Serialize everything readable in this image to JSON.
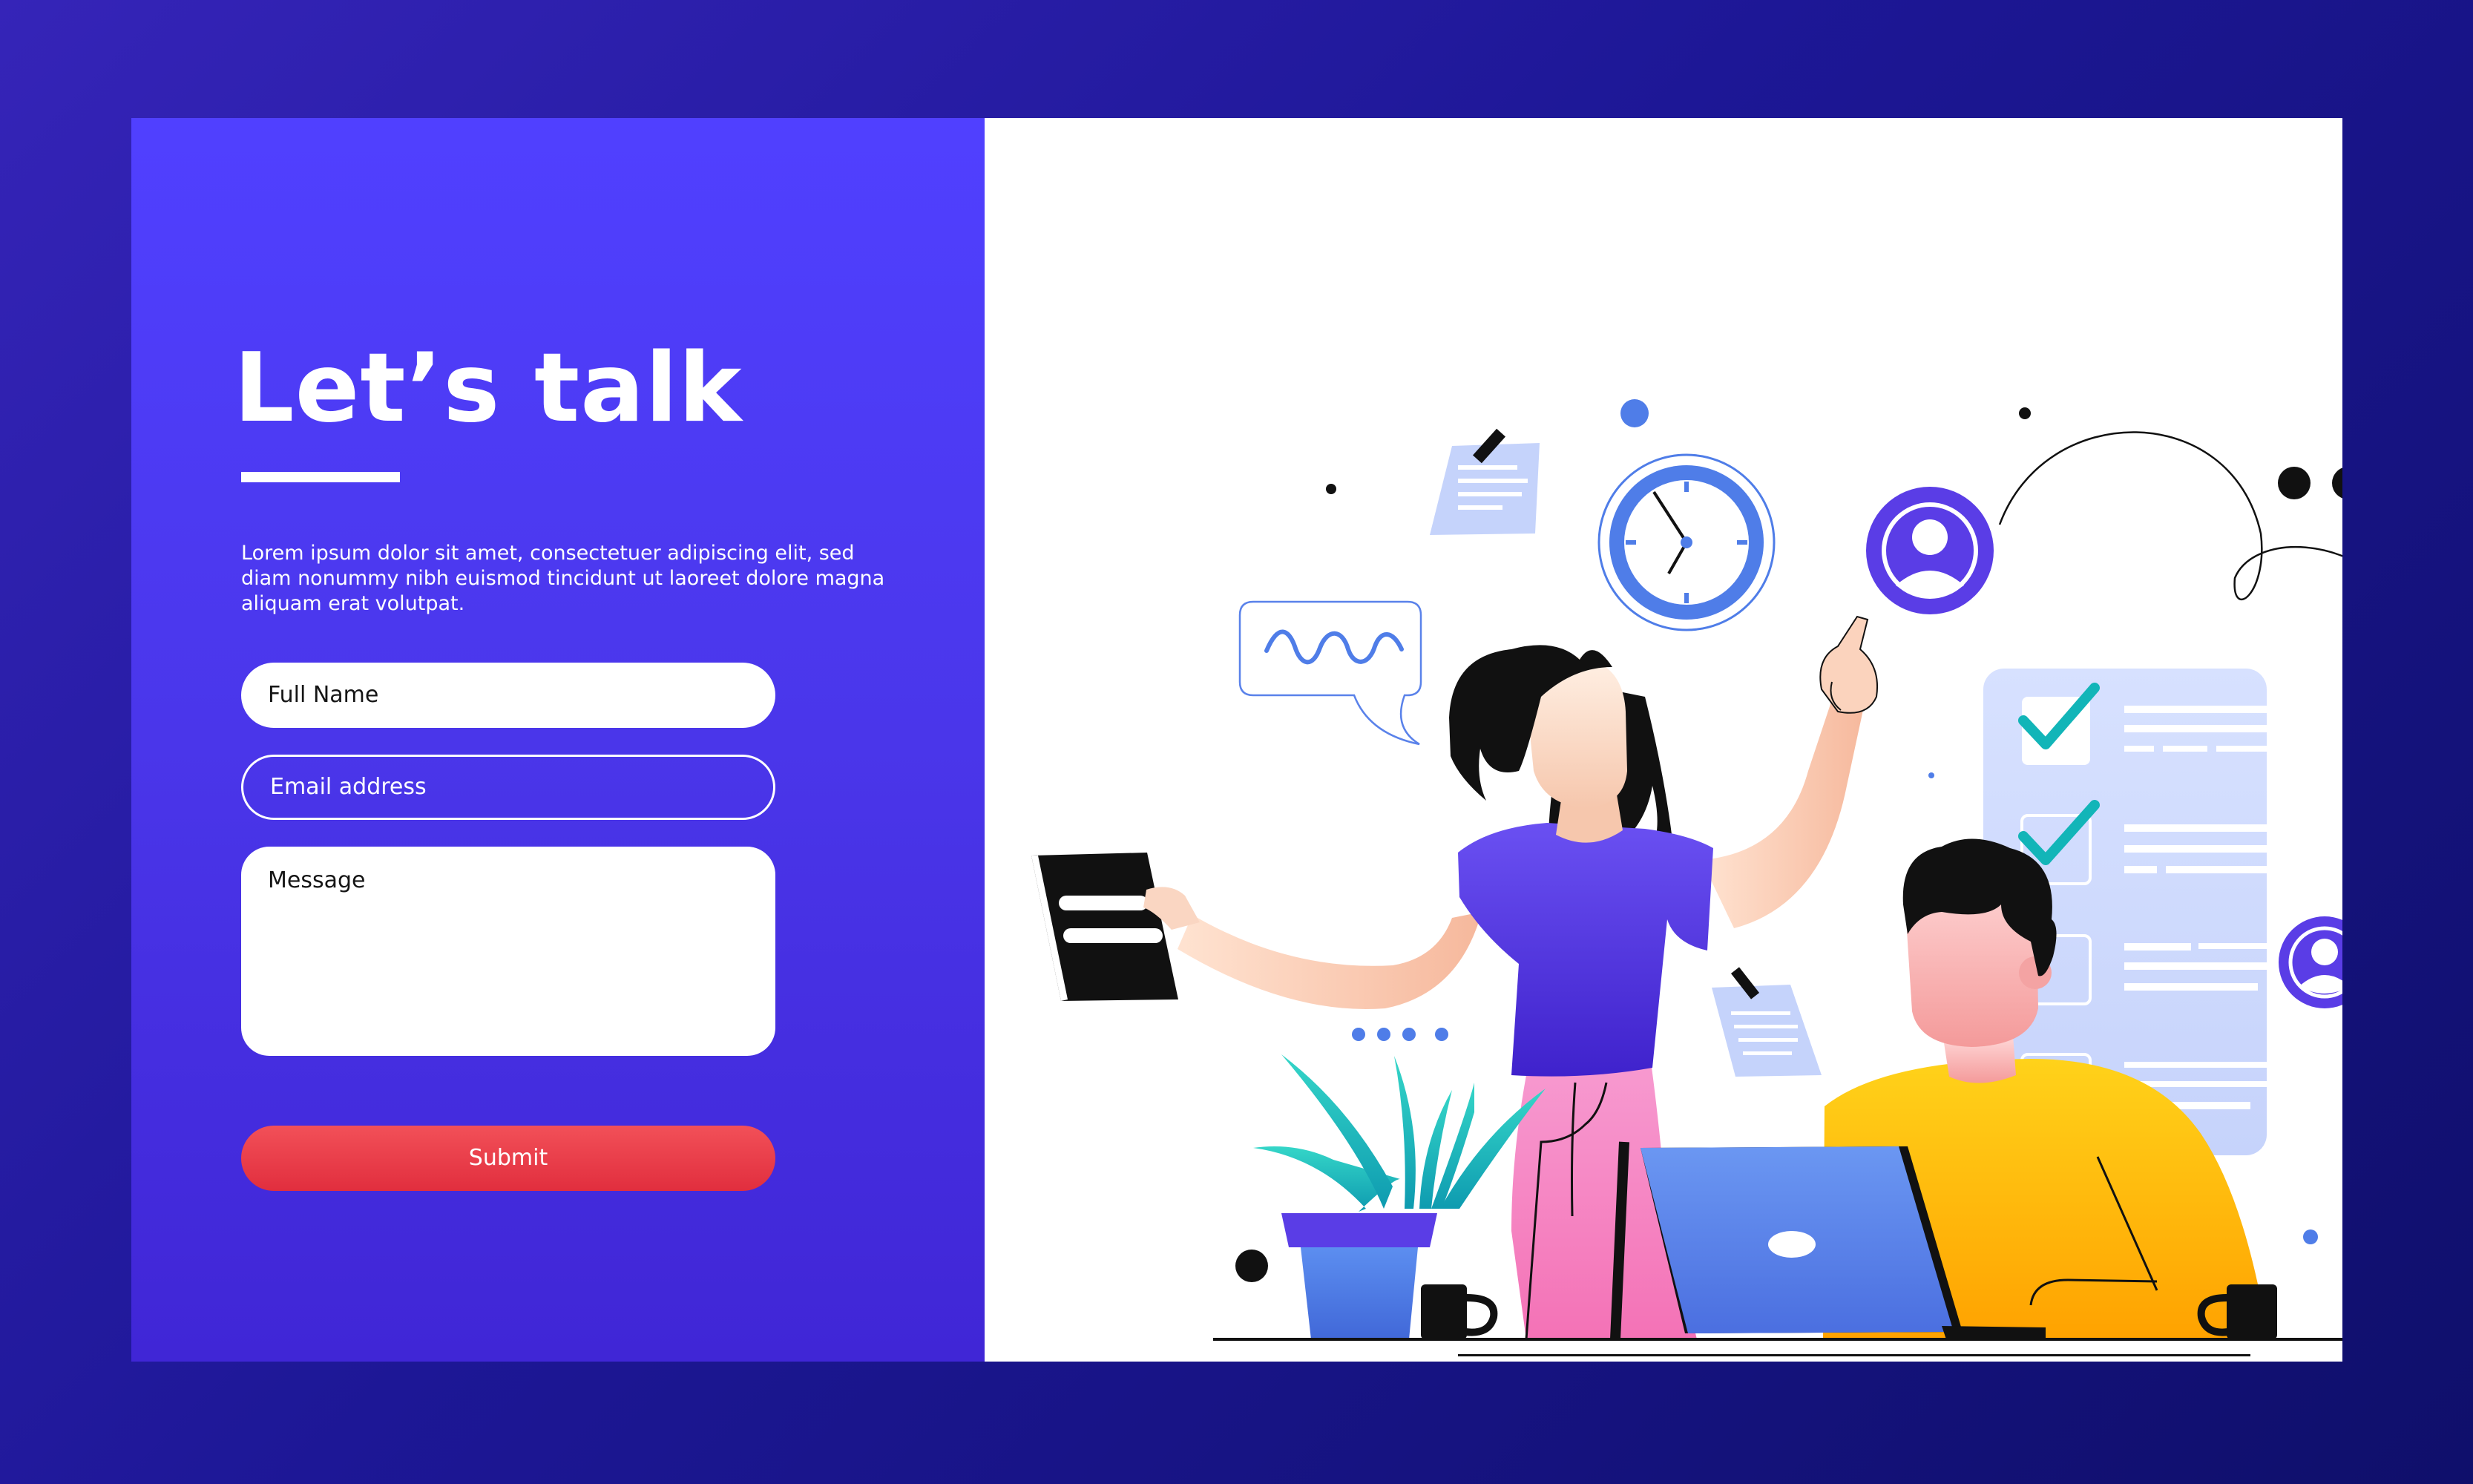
{
  "form": {
    "title": "Let’s talk",
    "description": "Lorem ipsum dolor sit amet, consectetuer adipiscing elit, sed diam nonummy nibh euismod tincidunt ut laoreet dolore magna aliquam erat volutpat.",
    "fields": {
      "full_name": "Full Name",
      "email": "Email address",
      "message": "Message"
    },
    "submit_label": "Submit"
  },
  "colors": {
    "background": "#1d1796",
    "panel": "#4a36ea",
    "submit": "#e8394a",
    "accent_blue": "#4f7de8",
    "teal": "#12b5b8",
    "skin": "#fbd3bd",
    "shirt_purple": "#5a3de6",
    "shirt_yellow": "#ffc414",
    "pants_pink": "#f58fc7"
  },
  "illustration": {
    "icons": [
      "clock-icon",
      "user-avatar-icon",
      "checkmark-icon",
      "sticky-note-icon",
      "speech-bubble-icon",
      "laptop-icon",
      "tablet-icon",
      "plant-icon",
      "coffee-mug-icon"
    ]
  }
}
